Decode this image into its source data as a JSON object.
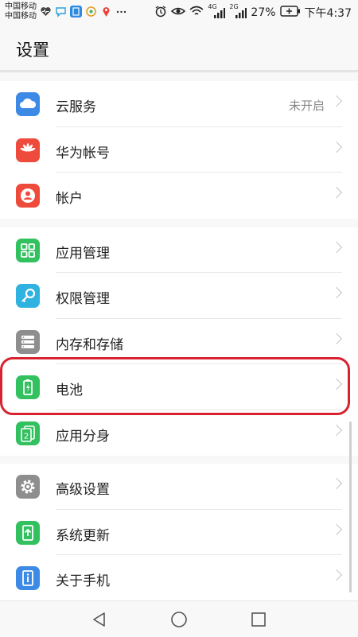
{
  "status": {
    "carrier1": "中国移动",
    "carrier2": "中国移动",
    "network1": "4G",
    "network2": "2G",
    "battery": "27%",
    "time": "下午4:37",
    "left_icons": [
      "heart-rate-icon",
      "chat-icon",
      "paste-icon",
      "photo-icon",
      "map-pin-icon",
      "more-icon"
    ],
    "right_icons": [
      "alarm-icon",
      "eye-icon",
      "wifi-icon",
      "signal-icon",
      "signal-icon",
      "battery-icon"
    ]
  },
  "header": {
    "title": "设置"
  },
  "groups": [
    {
      "items": [
        {
          "label": "云服务",
          "value": "未开启",
          "icon": "cloud-icon",
          "color": "#3c8ae6"
        },
        {
          "label": "华为帐号",
          "icon": "huawei-logo-icon",
          "color": "#ef4b3d"
        },
        {
          "label": "帐户",
          "icon": "account-icon",
          "color": "#ef4b3d"
        }
      ]
    },
    {
      "items": [
        {
          "label": "应用管理",
          "icon": "apps-grid-icon",
          "color": "#33c160"
        },
        {
          "label": "权限管理",
          "icon": "key-icon",
          "color": "#2fb2e0"
        },
        {
          "label": "内存和存储",
          "icon": "storage-icon",
          "color": "#8e8e8e"
        },
        {
          "label": "电池",
          "icon": "battery-settings-icon",
          "color": "#33c160"
        },
        {
          "label": "应用分身",
          "icon": "app-twin-icon",
          "color": "#33c160"
        }
      ]
    },
    {
      "items": [
        {
          "label": "高级设置",
          "icon": "gear-icon",
          "color": "#8e8e8e"
        },
        {
          "label": "系统更新",
          "icon": "system-update-icon",
          "color": "#33c160"
        },
        {
          "label": "关于手机",
          "icon": "info-icon",
          "color": "#3c8ae6"
        }
      ]
    }
  ],
  "nav": [
    "back-icon",
    "home-icon",
    "recents-icon"
  ],
  "colors": {
    "highlight": "#d9222f",
    "background": "#f8f8f8"
  }
}
